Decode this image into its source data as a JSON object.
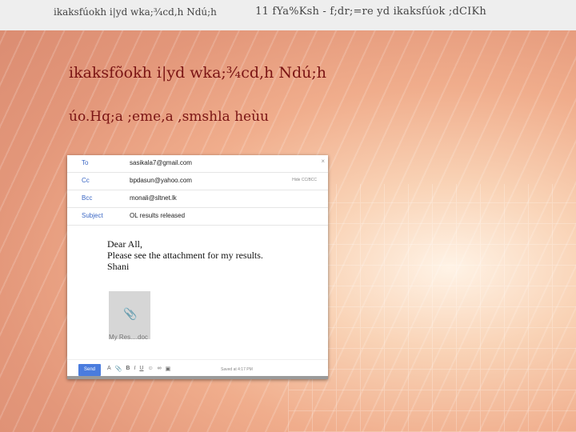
{
  "header": {
    "left_text": "ikaksfúokh i|yd wka;¾cd,h Ndú;h",
    "right_text": "11 fYa%Ksh - f;dr;=re yd ikaksfúok ;dCIKh"
  },
  "slide": {
    "heading": "ikaksfõokh i|yd wka;¾cd,h Ndú;h",
    "subheading": "úo.Hq;a ;eme,a ,smshla heùu"
  },
  "email": {
    "fields": [
      {
        "label": "To",
        "value": "sasikala7@gmail.com"
      },
      {
        "label": "Cc",
        "value": "bpdasun@yahoo.com"
      },
      {
        "label": "Bcc",
        "value": "monali@sltnet.lk"
      },
      {
        "label": "Subject",
        "value": "OL results released"
      }
    ],
    "cc_extra": "Hide CC/BCC",
    "close_symbol": "×",
    "body_lines": [
      "Dear All,",
      "Please see the attachment for my results.",
      "Shani"
    ],
    "attachment_name": "My Res....doc",
    "send_label": "Send",
    "toolbar_icons": [
      "format-icon",
      "attach-icon",
      "bold-icon",
      "italic-icon",
      "underline-icon",
      "emoji-icon",
      "link-icon",
      "image-icon"
    ],
    "saved_text": "Saved at 4:17 PM"
  }
}
